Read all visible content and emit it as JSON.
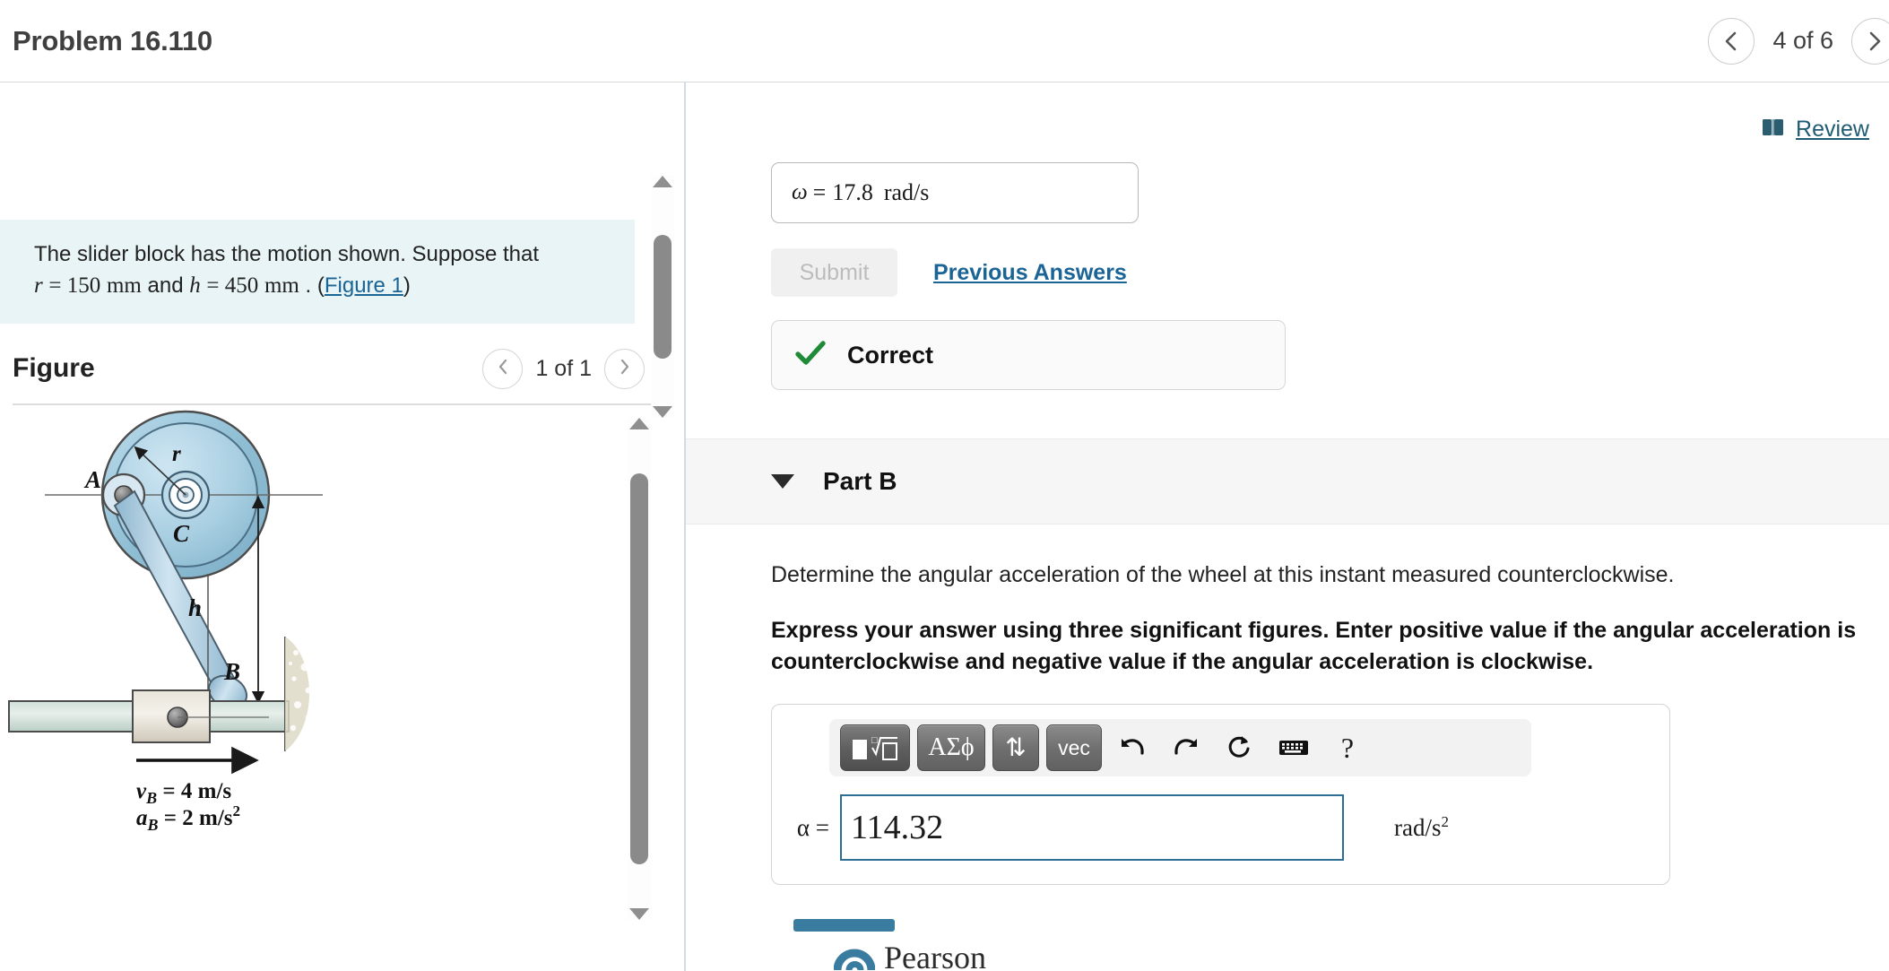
{
  "header": {
    "problem_title": "Problem 16.110",
    "pager_label": "4 of 6",
    "prev_icon": "chevron-left-icon",
    "next_icon": "chevron-right-icon"
  },
  "statement": {
    "line1": "The slider block has the motion shown. Suppose that",
    "r_symbol": "r",
    "r_eq": "= 150",
    "r_unit": "mm",
    "and_text": "and",
    "h_symbol": "h",
    "h_eq": "= 450",
    "h_unit": "mm",
    "period": ".",
    "open_paren": "(",
    "figure_link": "Figure 1",
    "close_paren": ")"
  },
  "figure": {
    "title": "Figure",
    "pager_label": "1 of 1",
    "labels": {
      "A": "A",
      "B": "B",
      "C": "C",
      "r": "r",
      "h": "h",
      "vB": "v",
      "vB_sub": "B",
      "vB_val": "= 4 m/s",
      "aB": "a",
      "aB_sub": "B",
      "aB_val": "= 2 m/s",
      "aB_exp": "2"
    }
  },
  "review": {
    "icon": "book-icon",
    "label": "Review"
  },
  "part_a": {
    "previous_answer": "ω =  17.8  rad/s",
    "omega": "ω",
    "equals": "=",
    "value": "17.8",
    "unit_num": "rad",
    "unit_den": "s",
    "submit_label": "Submit",
    "previous_answers_label": "Previous Answers",
    "status_label": "Correct",
    "status_icon": "check-icon",
    "status_color": "#1f8a38"
  },
  "part_b": {
    "caret_icon": "caret-down-icon",
    "label": "Part B",
    "question": "Determine the angular acceleration of the wheel at this instant measured counterclockwise.",
    "instruction": "Express your answer using three significant figures. Enter positive value if the angular acceleration is counterclockwise and negative value if the angular acceleration is clockwise.",
    "toolbar": [
      {
        "name": "template-button",
        "glyph": "■√□"
      },
      {
        "name": "greek-button",
        "glyph": "ΑΣϕ"
      },
      {
        "name": "updown-button",
        "glyph": "⇅"
      },
      {
        "name": "vector-button",
        "glyph": "vec"
      },
      {
        "name": "undo-button",
        "glyph": "↶"
      },
      {
        "name": "redo-button",
        "glyph": "↷"
      },
      {
        "name": "reset-button",
        "glyph": "↻"
      },
      {
        "name": "keyboard-button",
        "glyph": "⌨"
      },
      {
        "name": "help-button",
        "glyph": "?"
      }
    ],
    "answer_symbol": "α =",
    "answer_value": "114.32",
    "answer_units_num": "rad",
    "answer_units_den": "s",
    "answer_units_exp": "2"
  },
  "footer": {
    "brand": "Pearson",
    "logo_icon": "pearson-logo-icon"
  },
  "colors": {
    "statement_bg": "#e8f4f6",
    "link": "#1a6496",
    "review_link": "#1f5c73",
    "correct_green": "#1f8a38",
    "input_border": "#2e6e94",
    "pearson_blue": "#3a7ca0"
  }
}
